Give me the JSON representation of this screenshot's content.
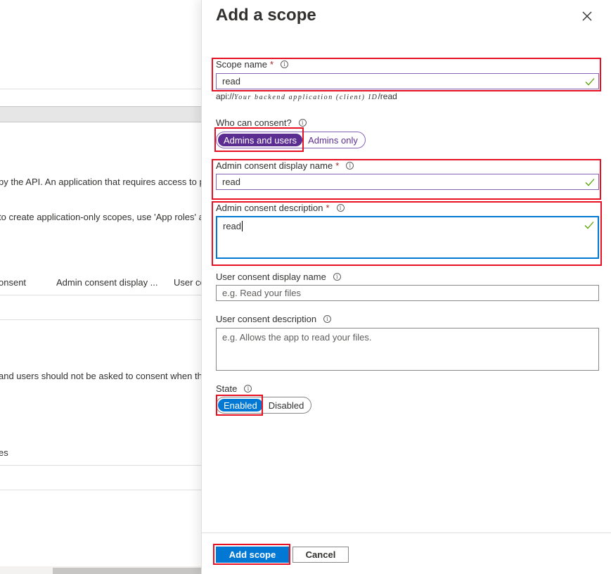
{
  "background": {
    "api_text": "by the API. An application that requires access to pa",
    "app_roles_text": "to create application-only scopes, use 'App roles' a",
    "col_consent": "onsent",
    "col_admin_display": "Admin consent display ...",
    "col_user": "User co",
    "users_text": "and users should not be asked to consent when th",
    "es_text": "es"
  },
  "panel": {
    "title": "Add a scope",
    "scope_name": {
      "label": "Scope name",
      "required": "*",
      "value": "read",
      "hint_prefix": "api://",
      "hint_italic": "Your backend application (client) ID",
      "hint_suffix": "/read"
    },
    "who_can_consent": {
      "label": "Who can consent?",
      "options": [
        "Admins and users",
        "Admins only"
      ],
      "selected": "Admins and users"
    },
    "admin_display_name": {
      "label": "Admin consent display name",
      "required": "*",
      "value": "read"
    },
    "admin_description": {
      "label": "Admin consent description",
      "required": "*",
      "value": "read"
    },
    "user_display_name": {
      "label": "User consent display name",
      "placeholder": "e.g. Read your files"
    },
    "user_description": {
      "label": "User consent description",
      "placeholder": "e.g. Allows the app to read your files."
    },
    "state": {
      "label": "State",
      "options": [
        "Enabled",
        "Disabled"
      ],
      "selected": "Enabled"
    },
    "footer": {
      "add_label": "Add scope",
      "cancel_label": "Cancel"
    }
  },
  "colors": {
    "accent_blue": "#0078d4",
    "accent_purple": "#5c2d91",
    "valid_green": "#57a300",
    "highlight_red": "#e81123"
  },
  "icons": [
    "close-icon",
    "info-icon",
    "checkmark-icon"
  ]
}
